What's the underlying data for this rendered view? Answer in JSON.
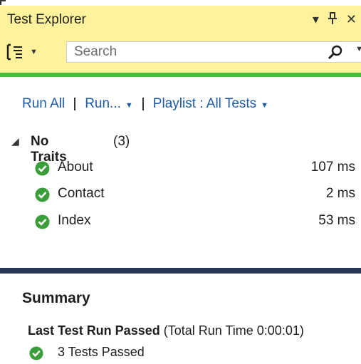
{
  "window": {
    "title": "Test Explorer"
  },
  "title_controls": [
    {
      "icon": "dropdown-caret-icon",
      "glyph": "▾"
    },
    {
      "icon": "pin-icon",
      "glyph": "⊥"
    },
    {
      "icon": "close-icon",
      "glyph": "✕"
    }
  ],
  "search": {
    "placeholder": "Search",
    "value": ""
  },
  "run_bar": {
    "run_all": "Run All",
    "run": "Run...",
    "playlist": "Playlist : All Tests"
  },
  "group": {
    "name": "No Traits",
    "count": "(3)"
  },
  "tests": [
    {
      "name": "About",
      "duration": "107 ms"
    },
    {
      "name": "Contact",
      "duration": "2 ms"
    },
    {
      "name": "Index",
      "duration": "53 ms"
    }
  ],
  "summary": {
    "title": "Summary",
    "last_run_label": "Last Test Run Passed",
    "last_run_detail": " (Total Run Time 0:00:01)",
    "passed_text": "3 Tests Passed"
  },
  "colors": {
    "title_bg": "#fff29d",
    "pass_green": "#3dc13d",
    "check_green": "#3a9e3a",
    "link_blue": "#1e5ba8",
    "splitter": "#293955"
  }
}
